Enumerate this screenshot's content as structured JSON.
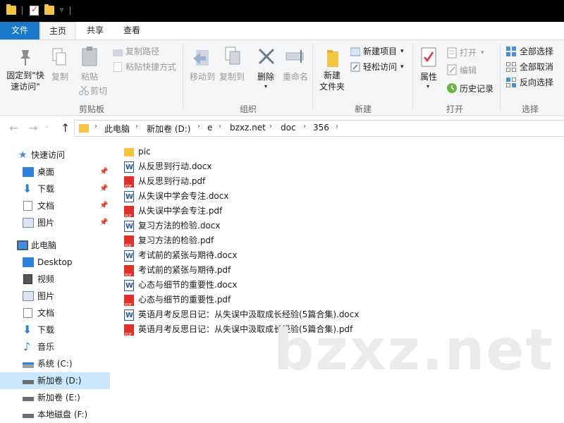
{
  "tabs": {
    "file": "文件",
    "home": "主页",
    "share": "共享",
    "view": "查看"
  },
  "ribbon": {
    "clipboard": {
      "label": "剪贴板",
      "pin": "固定到\"快\n速访问\"",
      "copy": "复制",
      "paste": "粘贴",
      "copy_path": "复制路径",
      "paste_shortcut": "粘贴快捷方式",
      "cut": "剪切"
    },
    "organize": {
      "label": "组织",
      "move_to": "移动到",
      "copy_to": "复制到",
      "delete": "删除",
      "rename": "重命名"
    },
    "new": {
      "label": "新建",
      "new_folder": "新建\n文件夹",
      "new_item": "新建项目",
      "easy_access": "轻松访问"
    },
    "open": {
      "label": "打开",
      "properties": "属性",
      "open": "打开",
      "edit": "编辑",
      "history": "历史记录"
    },
    "select": {
      "label": "选择",
      "select_all": "全部选择",
      "select_none": "全部取消",
      "invert": "反向选择"
    }
  },
  "address": {
    "crumbs": [
      "此电脑",
      "新加卷 (D:)",
      "e",
      "bzxz.net",
      "doc",
      "356"
    ]
  },
  "sidebar": {
    "quick_access": "快速访问",
    "desktop": "桌面",
    "downloads": "下载",
    "documents": "文档",
    "pictures": "图片",
    "this_pc": "此电脑",
    "desktop_en": "Desktop",
    "videos": "视频",
    "pictures2": "图片",
    "documents2": "文档",
    "downloads2": "下载",
    "music": "音乐",
    "drive_c": "系统 (C:)",
    "drive_d": "新加卷 (D:)",
    "drive_e": "新加卷 (E:)",
    "drive_f": "本地磁盘 (F:)"
  },
  "files": [
    {
      "name": "pic",
      "type": "folder"
    },
    {
      "name": "从反思到行动.docx",
      "type": "docx"
    },
    {
      "name": "从反思到行动.pdf",
      "type": "pdf"
    },
    {
      "name": "从失误中学会专注.docx",
      "type": "docx"
    },
    {
      "name": "从失误中学会专注.pdf",
      "type": "pdf"
    },
    {
      "name": "复习方法的检验.docx",
      "type": "docx"
    },
    {
      "name": "复习方法的检验.pdf",
      "type": "pdf"
    },
    {
      "name": "考试前的紧张与期待.docx",
      "type": "docx"
    },
    {
      "name": "考试前的紧张与期待.pdf",
      "type": "pdf"
    },
    {
      "name": "心态与细节的重要性.docx",
      "type": "docx"
    },
    {
      "name": "心态与细节的重要性.pdf",
      "type": "pdf"
    },
    {
      "name": "英语月考反思日记：从失误中汲取成长经验(5篇合集).docx",
      "type": "docx"
    },
    {
      "name": "英语月考反思日记：从失误中汲取成长经验(5篇合集).pdf",
      "type": "pdf"
    }
  ],
  "watermark": "bzxz.net",
  "colors": {
    "accent": "#1979ca",
    "selected": "#cce8ff",
    "folder": "#f4c542"
  }
}
